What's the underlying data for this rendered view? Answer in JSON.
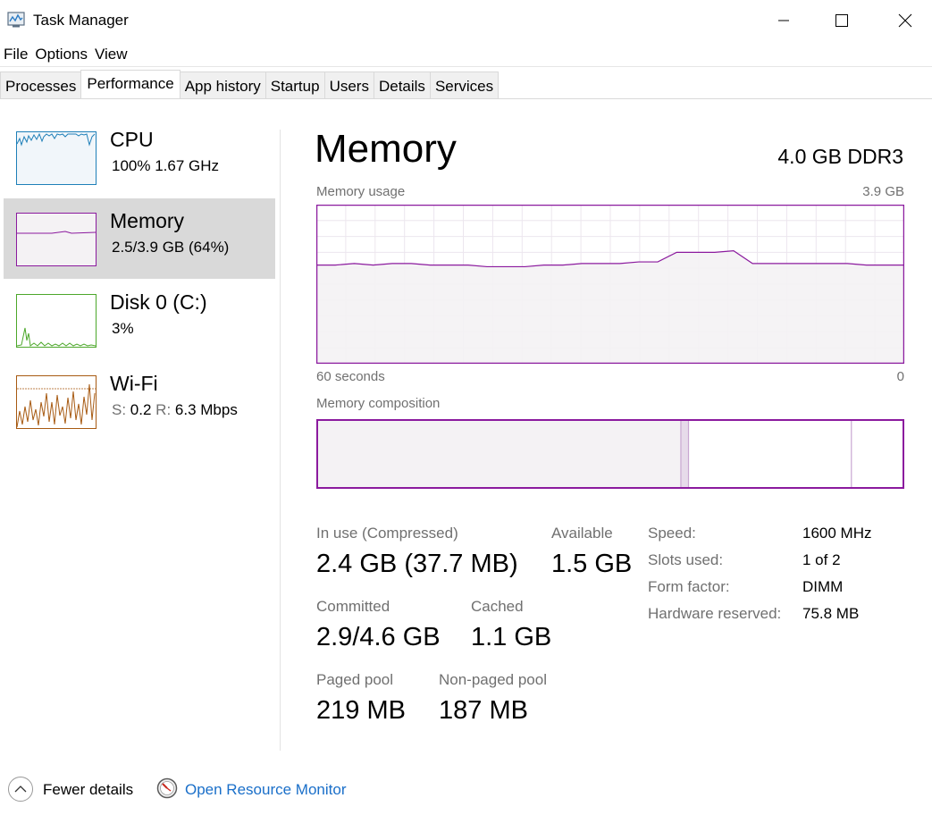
{
  "window": {
    "title": "Task Manager"
  },
  "menu": [
    "File",
    "Options",
    "View"
  ],
  "tabs": [
    {
      "label": "Processes",
      "active": false
    },
    {
      "label": "Performance",
      "active": true
    },
    {
      "label": "App history",
      "active": false
    },
    {
      "label": "Startup",
      "active": false
    },
    {
      "label": "Users",
      "active": false
    },
    {
      "label": "Details",
      "active": false
    },
    {
      "label": "Services",
      "active": false
    }
  ],
  "resources": [
    {
      "name": "CPU",
      "sub": "100%  1.67 GHz",
      "color": "#1e7fb8",
      "fill": "#f1f6fa",
      "selected": false,
      "icon": "cpu-graph"
    },
    {
      "name": "Memory",
      "sub": "2.5/3.9 GB (64%)",
      "color": "#8b1a9e",
      "fill": "#f4f2f4",
      "selected": true,
      "icon": "memory-graph"
    },
    {
      "name": "Disk 0 (C:)",
      "sub": "3%",
      "color": "#4ca72a",
      "fill": "#ffffff",
      "selected": false,
      "icon": "disk-graph"
    },
    {
      "name": "Wi-Fi",
      "sub_s_label": "S:",
      "sub_s": "0.2",
      "sub_r_label": "R:",
      "sub_r": "6.3 Mbps",
      "color": "#a75a12",
      "fill": "#ffffff",
      "selected": false,
      "icon": "wifi-graph"
    }
  ],
  "memory": {
    "title": "Memory",
    "spec": "4.0 GB DDR3",
    "usage_label": "Memory usage",
    "usage_max": "3.9 GB",
    "time_left": "60 seconds",
    "time_right": "0",
    "composition_label": "Memory composition",
    "accent": "#8b1a9e",
    "in_use_label": "In use (Compressed)",
    "in_use_value": "2.4 GB (37.7 MB)",
    "available_label": "Available",
    "available_value": "1.5 GB",
    "committed_label": "Committed",
    "committed_value": "2.9/4.6 GB",
    "cached_label": "Cached",
    "cached_value": "1.1 GB",
    "paged_label": "Paged pool",
    "paged_value": "219 MB",
    "nonpaged_label": "Non-paged pool",
    "nonpaged_value": "187 MB",
    "specs": [
      {
        "label": "Speed:",
        "value": "1600 MHz"
      },
      {
        "label": "Slots used:",
        "value": "1 of 2"
      },
      {
        "label": "Form factor:",
        "value": "DIMM"
      },
      {
        "label": "Hardware reserved:",
        "value": "75.8 MB"
      }
    ],
    "usage_history_pct": [
      62,
      62,
      63,
      62,
      63,
      63,
      62,
      62,
      62,
      61,
      61,
      61,
      62,
      62,
      63,
      63,
      63,
      64,
      64,
      70,
      70,
      70,
      71,
      63,
      63,
      63,
      63,
      63,
      63,
      62,
      62,
      62
    ],
    "composition_fractions": {
      "in_use": 0.62,
      "modified": 0.013,
      "standby": 0.277,
      "free": 0.09
    }
  },
  "footer": {
    "fewer_details": "Fewer details",
    "open_monitor": "Open Resource Monitor"
  }
}
